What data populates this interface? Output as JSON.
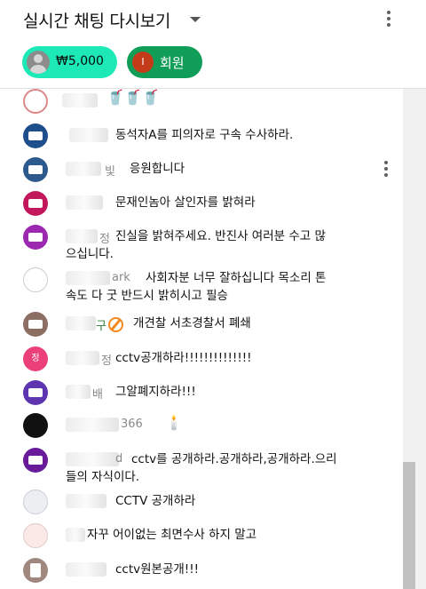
{
  "header": {
    "title": "실시간 채팅 다시보기",
    "more_icon": "more-vert-icon",
    "dropdown_icon": "arrow-drop-down-icon"
  },
  "chips": {
    "donation": "₩5,000",
    "member_initial": "I",
    "member_label": "회원"
  },
  "messages": [
    {
      "name": "",
      "text": "",
      "emoji": "🥤🥤🥤"
    },
    {
      "name": "",
      "text": "동석자A를 피의자로 구속 수사하라."
    },
    {
      "name": "빛",
      "text": "응원합니다"
    },
    {
      "name": "",
      "text": "문재인놈아 살인자를 밝혀라"
    },
    {
      "name": "정",
      "text": "진실을 밝혀주세요. 반진사 여러분 수고 많",
      "text2": "으십니다."
    },
    {
      "name": "ark",
      "text": "사회자분 너무 잘하십니다 목소리 톤",
      "text2": "속도 다 굿 반드시 밝히시고 필승"
    },
    {
      "name": "구",
      "text": "개견찰 서초경찰서 폐쇄"
    },
    {
      "name": "정",
      "text": "cctv공개하라!!!!!!!!!!!!!!"
    },
    {
      "name": "배",
      "text": "그알폐지하라!!!"
    },
    {
      "name": "366",
      "text": "",
      "emoji": "🕯️"
    },
    {
      "name": "d",
      "text": "cctv를 공개하라.공개하라,공개하라.으리",
      "text2": "들의 자식이다."
    },
    {
      "name": "",
      "text": "CCTV 공개하라"
    },
    {
      "name": "",
      "text": "자꾸 어이없는 최면수사 하지 말고"
    },
    {
      "name": "",
      "text": "cctv원본공개!!!"
    }
  ],
  "avatar_badges": {
    "row7": "정"
  },
  "colors": {
    "donation_chip": "#1de9b6",
    "member_chip": "#0f9d58",
    "member_avatar": "#c43b19"
  }
}
